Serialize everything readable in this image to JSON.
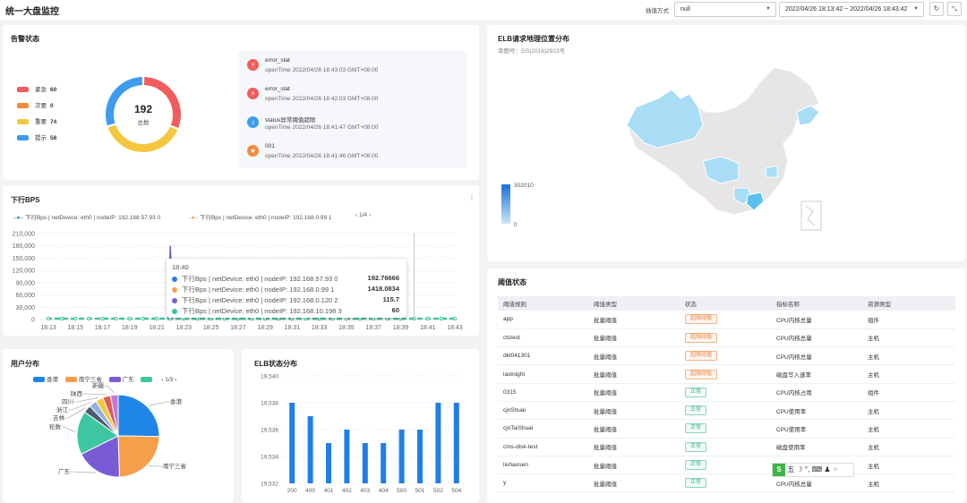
{
  "header": {
    "title": "统一大盘监控",
    "interp_label": "插值方式",
    "interp_value": "null",
    "time_range": "2022/04/26 18:13:42 ~ 2022/04/26 18:43:42"
  },
  "alarm": {
    "title": "告警状态",
    "total": "192",
    "total_label": "总数",
    "legend": [
      {
        "name": "紧急",
        "value": "60",
        "color": "#f25c5c"
      },
      {
        "name": "次要",
        "value": "0",
        "color": "#f58a3a"
      },
      {
        "name": "重要",
        "value": "74",
        "color": "#f4c73e"
      },
      {
        "name": "提示",
        "value": "58",
        "color": "#3d9cf0"
      }
    ],
    "alerts": [
      {
        "name": "error_stat",
        "time": "openTime 2022/04/26 18:43:03 GMT+08:00",
        "icon": "lightning-icon",
        "color": "#f25c5c"
      },
      {
        "name": "error_stat",
        "time": "openTime 2022/04/26 18:42:03 GMT+08:00",
        "icon": "lightning-icon",
        "color": "#f25c5c"
      },
      {
        "name": "status异常阈值超限",
        "time": "openTime 2022/04/26 18:41:47 GMT+08:00",
        "icon": "bell-icon",
        "color": "#3d9cf0"
      },
      {
        "name": "001",
        "time": "openTime 2022/04/26 18:41:46 GMT+08:00",
        "icon": "star-icon",
        "color": "#f58a3a"
      }
    ]
  },
  "map": {
    "title": "ELB请求地理位置分布",
    "subtitle": "审图号：GS(2016)2923号",
    "scale_max": "302010",
    "scale_min": "0"
  },
  "bps": {
    "title": "下行BPS",
    "legend1": "下行Bps | netDevice: eth0 | nodeIP: 192.168.57.93 0",
    "legend2": "下行Bps | netDevice: eth0 | nodeIP: 192.168.0.99 1",
    "page": "1/4"
  },
  "tooltip": {
    "time": "18:40",
    "rows": [
      {
        "label": "下行Bps | netDevice: eth0 | nodeIP: 192.168.57.93 0",
        "value": "192.76666",
        "color": "#2f7de1"
      },
      {
        "label": "下行Bps | netDevice: eth0 | nodeIP: 192.168.0.99 1",
        "value": "1418.0834",
        "color": "#f5a04a"
      },
      {
        "label": "下行Bps | netDevice: eth0 | nodeIP: 192.168.0.120 2",
        "value": "115.7",
        "color": "#7b5cd6"
      },
      {
        "label": "下行Bps | netDevice: eth0 | nodeIP: 192.168.10.198 3",
        "value": "60",
        "color": "#3ec6a0"
      }
    ]
  },
  "user": {
    "title": "用户分布",
    "legend": [
      "香港",
      "南宁三省",
      "广东",
      ""
    ],
    "page": "1/3"
  },
  "elb": {
    "title": "ELB状态分布"
  },
  "threshold": {
    "title": "阈值状态",
    "columns": [
      "阈值规则",
      "阈值类型",
      "状态",
      "指标名称",
      "资源类型"
    ],
    "rows": [
      {
        "rule": "app",
        "type": "批量阈值",
        "status": "超限阈值",
        "status_kind": "warn",
        "metric": "CPU内核总量",
        "res": "组件"
      },
      {
        "rule": "ctstest",
        "type": "批量阈值",
        "status": "超限阈值",
        "status_kind": "warn",
        "metric": "CPU内核总量",
        "res": "主机"
      },
      {
        "rule": "dkt041301",
        "type": "批量阈值",
        "status": "超限阈值",
        "status_kind": "warn",
        "metric": "CPU内核总量",
        "res": "主机"
      },
      {
        "rule": "lastnight",
        "type": "批量阈值",
        "status": "超限阈值",
        "status_kind": "warn",
        "metric": "磁盘写入速率",
        "res": "主机"
      },
      {
        "rule": "0315",
        "type": "批量阈值",
        "status": "正常",
        "status_kind": "ok",
        "metric": "CPU内核占用",
        "res": "组件"
      },
      {
        "rule": "cjnShuai",
        "type": "批量阈值",
        "status": "正常",
        "status_kind": "ok",
        "metric": "CPU使用率",
        "res": "主机"
      },
      {
        "rule": "cjnTaiShuai",
        "type": "批量阈值",
        "status": "正常",
        "status_kind": "ok",
        "metric": "CPU使用率",
        "res": "主机"
      },
      {
        "rule": "cms-disk-test",
        "type": "批量阈值",
        "status": "正常",
        "status_kind": "ok",
        "metric": "磁盘使用率",
        "res": "主机"
      },
      {
        "rule": "liuhaosen",
        "type": "批量阈值",
        "status": "正常",
        "status_kind": "ok",
        "metric": "",
        "res": "主机"
      },
      {
        "rule": "y",
        "type": "批量阈值",
        "status": "正常",
        "status_kind": "ok",
        "metric": "CPU内核总量",
        "res": "主机"
      }
    ]
  },
  "chart_data": [
    {
      "type": "pie",
      "title": "告警状态",
      "categories": [
        "紧急",
        "次要",
        "重要",
        "提示"
      ],
      "values": [
        60,
        0,
        74,
        58
      ],
      "colors": [
        "#f25c5c",
        "#f58a3a",
        "#f4c73e",
        "#3d9cf0"
      ]
    },
    {
      "type": "line",
      "title": "下行BPS",
      "x": [
        "18:13",
        "18:15",
        "18:17",
        "18:19",
        "18:21",
        "18:23",
        "18:25",
        "18:27",
        "18:29",
        "18:31",
        "18:33",
        "18:35",
        "18:37",
        "18:39",
        "18:41",
        "18:43"
      ],
      "ylim": [
        0,
        210000
      ],
      "yticks": [
        "210,000",
        "180,000",
        "150,000",
        "120,000",
        "90,000",
        "60,000",
        "30,000",
        "0"
      ],
      "series": [
        {
          "spike_x": "18:22",
          "spike_value": 180000
        }
      ]
    },
    {
      "type": "pie",
      "title": "用户分布",
      "categories": [
        "香港",
        "南宁三省",
        "广东",
        "轮数",
        "吉林",
        "浙江",
        "四川",
        "陕西",
        "新疆"
      ],
      "values": [
        25,
        24,
        18,
        17,
        3,
        3,
        3,
        3,
        3
      ],
      "colors": [
        "#1f85e6",
        "#f5a04a",
        "#7a5bd6",
        "#3ec6a0",
        "#4a5a70",
        "#8fb0e0",
        "#f4c73e",
        "#e05a5a",
        "#c27ad0"
      ]
    },
    {
      "type": "bar",
      "title": "ELB状态分布",
      "categories": [
        "200",
        "400",
        "401",
        "402",
        "403",
        "404",
        "500",
        "501",
        "502",
        "504"
      ],
      "values": [
        19538,
        19537,
        19535,
        19536,
        19535,
        19535,
        19536,
        19536,
        19538,
        19538
      ],
      "ylim": [
        19532,
        19540
      ],
      "yticks": [
        "19,540",
        "19,538",
        "19,536",
        "19,534",
        "19,532"
      ]
    }
  ]
}
